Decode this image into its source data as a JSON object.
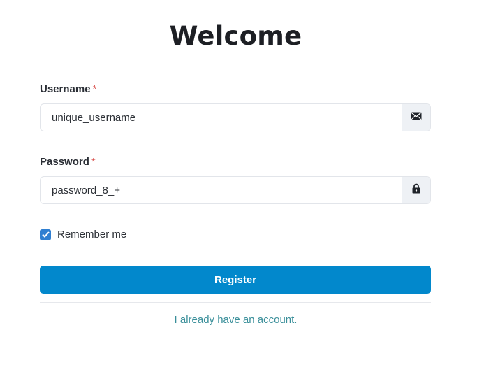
{
  "page": {
    "title": "Welcome"
  },
  "form": {
    "username": {
      "label": "Username",
      "required_mark": "*",
      "value": "unique_username",
      "icon": "envelope-icon"
    },
    "password": {
      "label": "Password",
      "required_mark": "*",
      "value": "password_8_+",
      "icon": "lock-icon"
    },
    "remember": {
      "label": "Remember me",
      "checked": true
    },
    "submit_label": "Register",
    "login_link": "I already have an account."
  },
  "colors": {
    "primary": "#0288cc",
    "link": "#3a8f9a",
    "required": "#d9534f",
    "checkbox": "#2f7fd1"
  }
}
